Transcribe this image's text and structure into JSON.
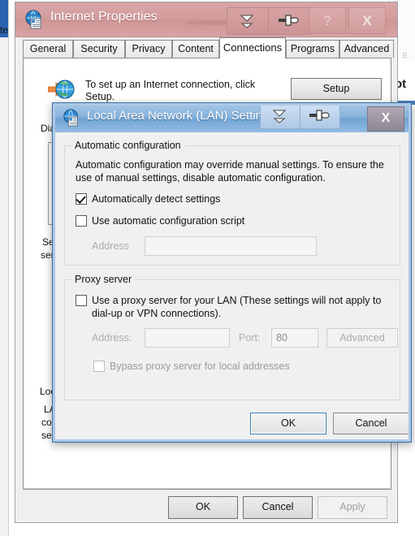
{
  "background": {
    "right_fragment_dots": "⠿",
    "right_fragment_word": "ot",
    "obscured_labels": {
      "dial": "Dial",
      "se": "Se",
      "ser": "ser",
      "loc": "Loc",
      "la": "LA",
      "co": "co",
      "se2": "se"
    }
  },
  "internet_properties": {
    "title": "Internet Properties",
    "title_icon": "internet-properties-icon",
    "quick_buttons": [
      {
        "name": "autohide-dropdown-icon"
      },
      {
        "name": "pin-icon"
      }
    ],
    "help_label": "?",
    "close_label": "X",
    "tabs": [
      {
        "label": "General",
        "active": false
      },
      {
        "label": "Security",
        "active": false
      },
      {
        "label": "Privacy",
        "active": false
      },
      {
        "label": "Content",
        "active": false
      },
      {
        "label": "Connections",
        "active": true
      },
      {
        "label": "Programs",
        "active": false
      },
      {
        "label": "Advanced",
        "active": false
      }
    ],
    "setup": {
      "icon": "globe-with-arrow-icon",
      "text": "To set up an Internet connection, click Setup.",
      "button_label": "Setup"
    },
    "footer_buttons": [
      {
        "label": "OK",
        "disabled": false
      },
      {
        "label": "Cancel",
        "disabled": false
      },
      {
        "label": "Apply",
        "disabled": true
      }
    ]
  },
  "lan_settings": {
    "title": "Local Area Network (LAN) Settings",
    "title_icon": "internet-properties-icon",
    "quick_buttons": [
      {
        "name": "autohide-dropdown-icon"
      },
      {
        "name": "pin-icon"
      }
    ],
    "close_label": "X",
    "automatic_configuration": {
      "group_title": "Automatic configuration",
      "description": "Automatic configuration may override manual settings.  To ensure the use of manual settings, disable automatic configuration.",
      "auto_detect": {
        "label": "Automatically detect settings",
        "checked": true
      },
      "use_script": {
        "label": "Use automatic configuration script",
        "checked": false
      },
      "address_label": "Address",
      "address_value": "",
      "address_placeholder": ""
    },
    "proxy_server": {
      "group_title": "Proxy server",
      "use_proxy": {
        "label": "Use a proxy server for your LAN (These settings will not apply to dial-up or VPN connections).",
        "checked": false
      },
      "address_label": "Address:",
      "address_value": "",
      "port_label": "Port:",
      "port_value": "80",
      "advanced_label": "Advanced",
      "bypass": {
        "label": "Bypass proxy server for local addresses",
        "checked": false
      }
    },
    "buttons": [
      {
        "label": "OK",
        "default": true
      },
      {
        "label": "Cancel",
        "default": false
      }
    ]
  },
  "colors": {
    "ip_titlebar": "#d49d9d",
    "lan_titlebar": "#86b2db",
    "default_button_border": "#3c7fb1",
    "dialog_face": "#f0f0f0"
  }
}
